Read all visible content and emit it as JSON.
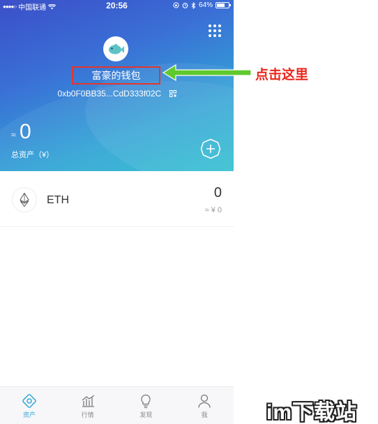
{
  "status_bar": {
    "carrier": "中国联通",
    "time": "20:56",
    "battery": "64%"
  },
  "wallet": {
    "name": "富豪的钱包",
    "address": "0xb0F0BB35...CdD333f02C",
    "approx_symbol": "≈",
    "total_balance": "0",
    "total_label": "总资产（¥）"
  },
  "tokens": [
    {
      "symbol": "ETH",
      "amount": "0",
      "value": "≈ ¥ 0"
    }
  ],
  "tabs": [
    {
      "label": "资产",
      "icon": "assets-icon",
      "active": true
    },
    {
      "label": "行情",
      "icon": "market-chart-icon",
      "active": false
    },
    {
      "label": "发现",
      "icon": "lightbulb-icon",
      "active": false
    },
    {
      "label": "我",
      "icon": "person-icon",
      "active": false
    }
  ],
  "annotation": {
    "text": "点击这里"
  },
  "watermark": "im下载站",
  "colors": {
    "header_start": "#3b4fc8",
    "header_end": "#2dbfcf",
    "highlight_box": "#e5352b",
    "arrow": "#5fc92e",
    "annotation_text": "#e8271e",
    "tab_active": "#2fa7d8"
  }
}
